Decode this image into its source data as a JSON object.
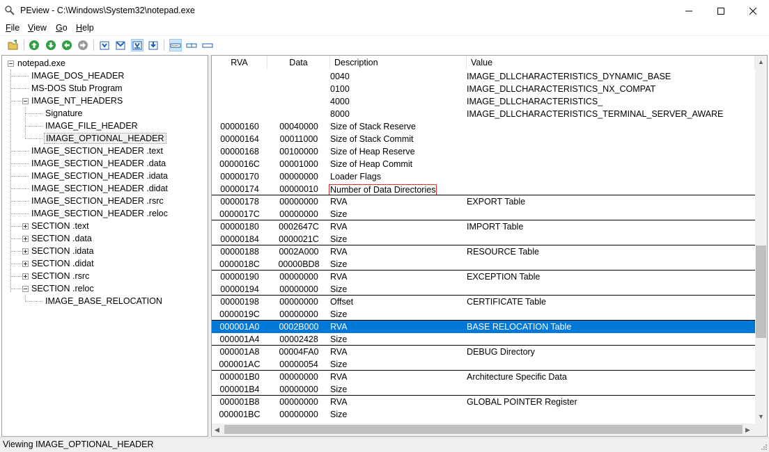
{
  "window": {
    "title": "PEview - C:\\Windows\\System32\\notepad.exe",
    "minimize_glyph": "minimize-icon",
    "maximize_glyph": "maximize-icon",
    "close_glyph": "close-icon"
  },
  "menu": {
    "file": {
      "u": "F",
      "rest": "ile"
    },
    "view": {
      "u": "V",
      "rest": "iew"
    },
    "go": {
      "u": "G",
      "rest": "o"
    },
    "help": {
      "u": "H",
      "rest": "elp"
    }
  },
  "toolbar": {
    "icons": [
      "open-icon",
      "up-icon",
      "down-icon",
      "back-icon",
      "forward-icon",
      "view-byte-icon",
      "view-word-icon",
      "view-dword-icon",
      "view-qword-icon",
      "list-view-icon",
      "hex-view-icon",
      "raw-view-icon"
    ],
    "accent": "#0078d7"
  },
  "tree": {
    "root": "notepad.exe",
    "items": [
      "IMAGE_DOS_HEADER",
      "MS-DOS Stub Program",
      "IMAGE_NT_HEADERS",
      "Signature",
      "IMAGE_FILE_HEADER",
      "IMAGE_OPTIONAL_HEADER",
      "IMAGE_SECTION_HEADER .text",
      "IMAGE_SECTION_HEADER .data",
      "IMAGE_SECTION_HEADER .idata",
      "IMAGE_SECTION_HEADER .didat",
      "IMAGE_SECTION_HEADER .rsrc",
      "IMAGE_SECTION_HEADER .reloc",
      "SECTION .text",
      "SECTION .data",
      "SECTION .idata",
      "SECTION .didat",
      "SECTION .rsrc",
      "SECTION .reloc",
      "IMAGE_BASE_RELOCATION"
    ],
    "selected": "IMAGE_OPTIONAL_HEADER"
  },
  "list": {
    "columns": {
      "rva": "RVA",
      "data": "Data",
      "description": "Description",
      "value": "Value"
    },
    "rows": [
      {
        "rva": "",
        "data": "",
        "description": "0040",
        "value": "IMAGE_DLLCHARACTERISTICS_DYNAMIC_BASE"
      },
      {
        "rva": "",
        "data": "",
        "description": "0100",
        "value": "IMAGE_DLLCHARACTERISTICS_NX_COMPAT"
      },
      {
        "rva": "",
        "data": "",
        "description": "4000",
        "value": "IMAGE_DLLCHARACTERISTICS_"
      },
      {
        "rva": "",
        "data": "",
        "description": "8000",
        "value": "IMAGE_DLLCHARACTERISTICS_TERMINAL_SERVER_AWARE"
      },
      {
        "rva": "00000160",
        "data": "00040000",
        "description": "Size of Stack Reserve",
        "value": ""
      },
      {
        "rva": "00000164",
        "data": "00011000",
        "description": "Size of Stack Commit",
        "value": ""
      },
      {
        "rva": "00000168",
        "data": "00100000",
        "description": "Size of Heap Reserve",
        "value": ""
      },
      {
        "rva": "0000016C",
        "data": "00001000",
        "description": "Size of Heap Commit",
        "value": ""
      },
      {
        "rva": "00000170",
        "data": "00000000",
        "description": "Loader Flags",
        "value": ""
      },
      {
        "rva": "00000174",
        "data": "00000010",
        "description": "Number of Data Directories",
        "value": ""
      },
      {
        "rva": "00000178",
        "data": "00000000",
        "description": "RVA",
        "value": "EXPORT Table"
      },
      {
        "rva": "0000017C",
        "data": "00000000",
        "description": "Size",
        "value": ""
      },
      {
        "rva": "00000180",
        "data": "0002647C",
        "description": "RVA",
        "value": "IMPORT Table"
      },
      {
        "rva": "00000184",
        "data": "0000021C",
        "description": "Size",
        "value": ""
      },
      {
        "rva": "00000188",
        "data": "0002A000",
        "description": "RVA",
        "value": "RESOURCE Table"
      },
      {
        "rva": "0000018C",
        "data": "00000BD8",
        "description": "Size",
        "value": ""
      },
      {
        "rva": "00000190",
        "data": "00000000",
        "description": "RVA",
        "value": "EXCEPTION Table"
      },
      {
        "rva": "00000194",
        "data": "00000000",
        "description": "Size",
        "value": ""
      },
      {
        "rva": "00000198",
        "data": "00000000",
        "description": "Offset",
        "value": "CERTIFICATE Table"
      },
      {
        "rva": "0000019C",
        "data": "00000000",
        "description": "Size",
        "value": ""
      },
      {
        "rva": "000001A0",
        "data": "0002B000",
        "description": "RVA",
        "value": "BASE RELOCATION Table"
      },
      {
        "rva": "000001A4",
        "data": "00002428",
        "description": "Size",
        "value": ""
      },
      {
        "rva": "000001A8",
        "data": "00004FA0",
        "description": "RVA",
        "value": "DEBUG Directory"
      },
      {
        "rva": "000001AC",
        "data": "00000054",
        "description": "Size",
        "value": ""
      },
      {
        "rva": "000001B0",
        "data": "00000000",
        "description": "RVA",
        "value": "Architecture Specific Data"
      },
      {
        "rva": "000001B4",
        "data": "00000000",
        "description": "Size",
        "value": ""
      },
      {
        "rva": "000001B8",
        "data": "00000000",
        "description": "RVA",
        "value": "GLOBAL POINTER Register"
      },
      {
        "rva": "000001BC",
        "data": "00000000",
        "description": "Size",
        "value": ""
      }
    ],
    "selected_rva": "000001A0",
    "focused_rva": "00000174"
  },
  "status": {
    "text": "Viewing IMAGE_OPTIONAL_HEADER"
  }
}
